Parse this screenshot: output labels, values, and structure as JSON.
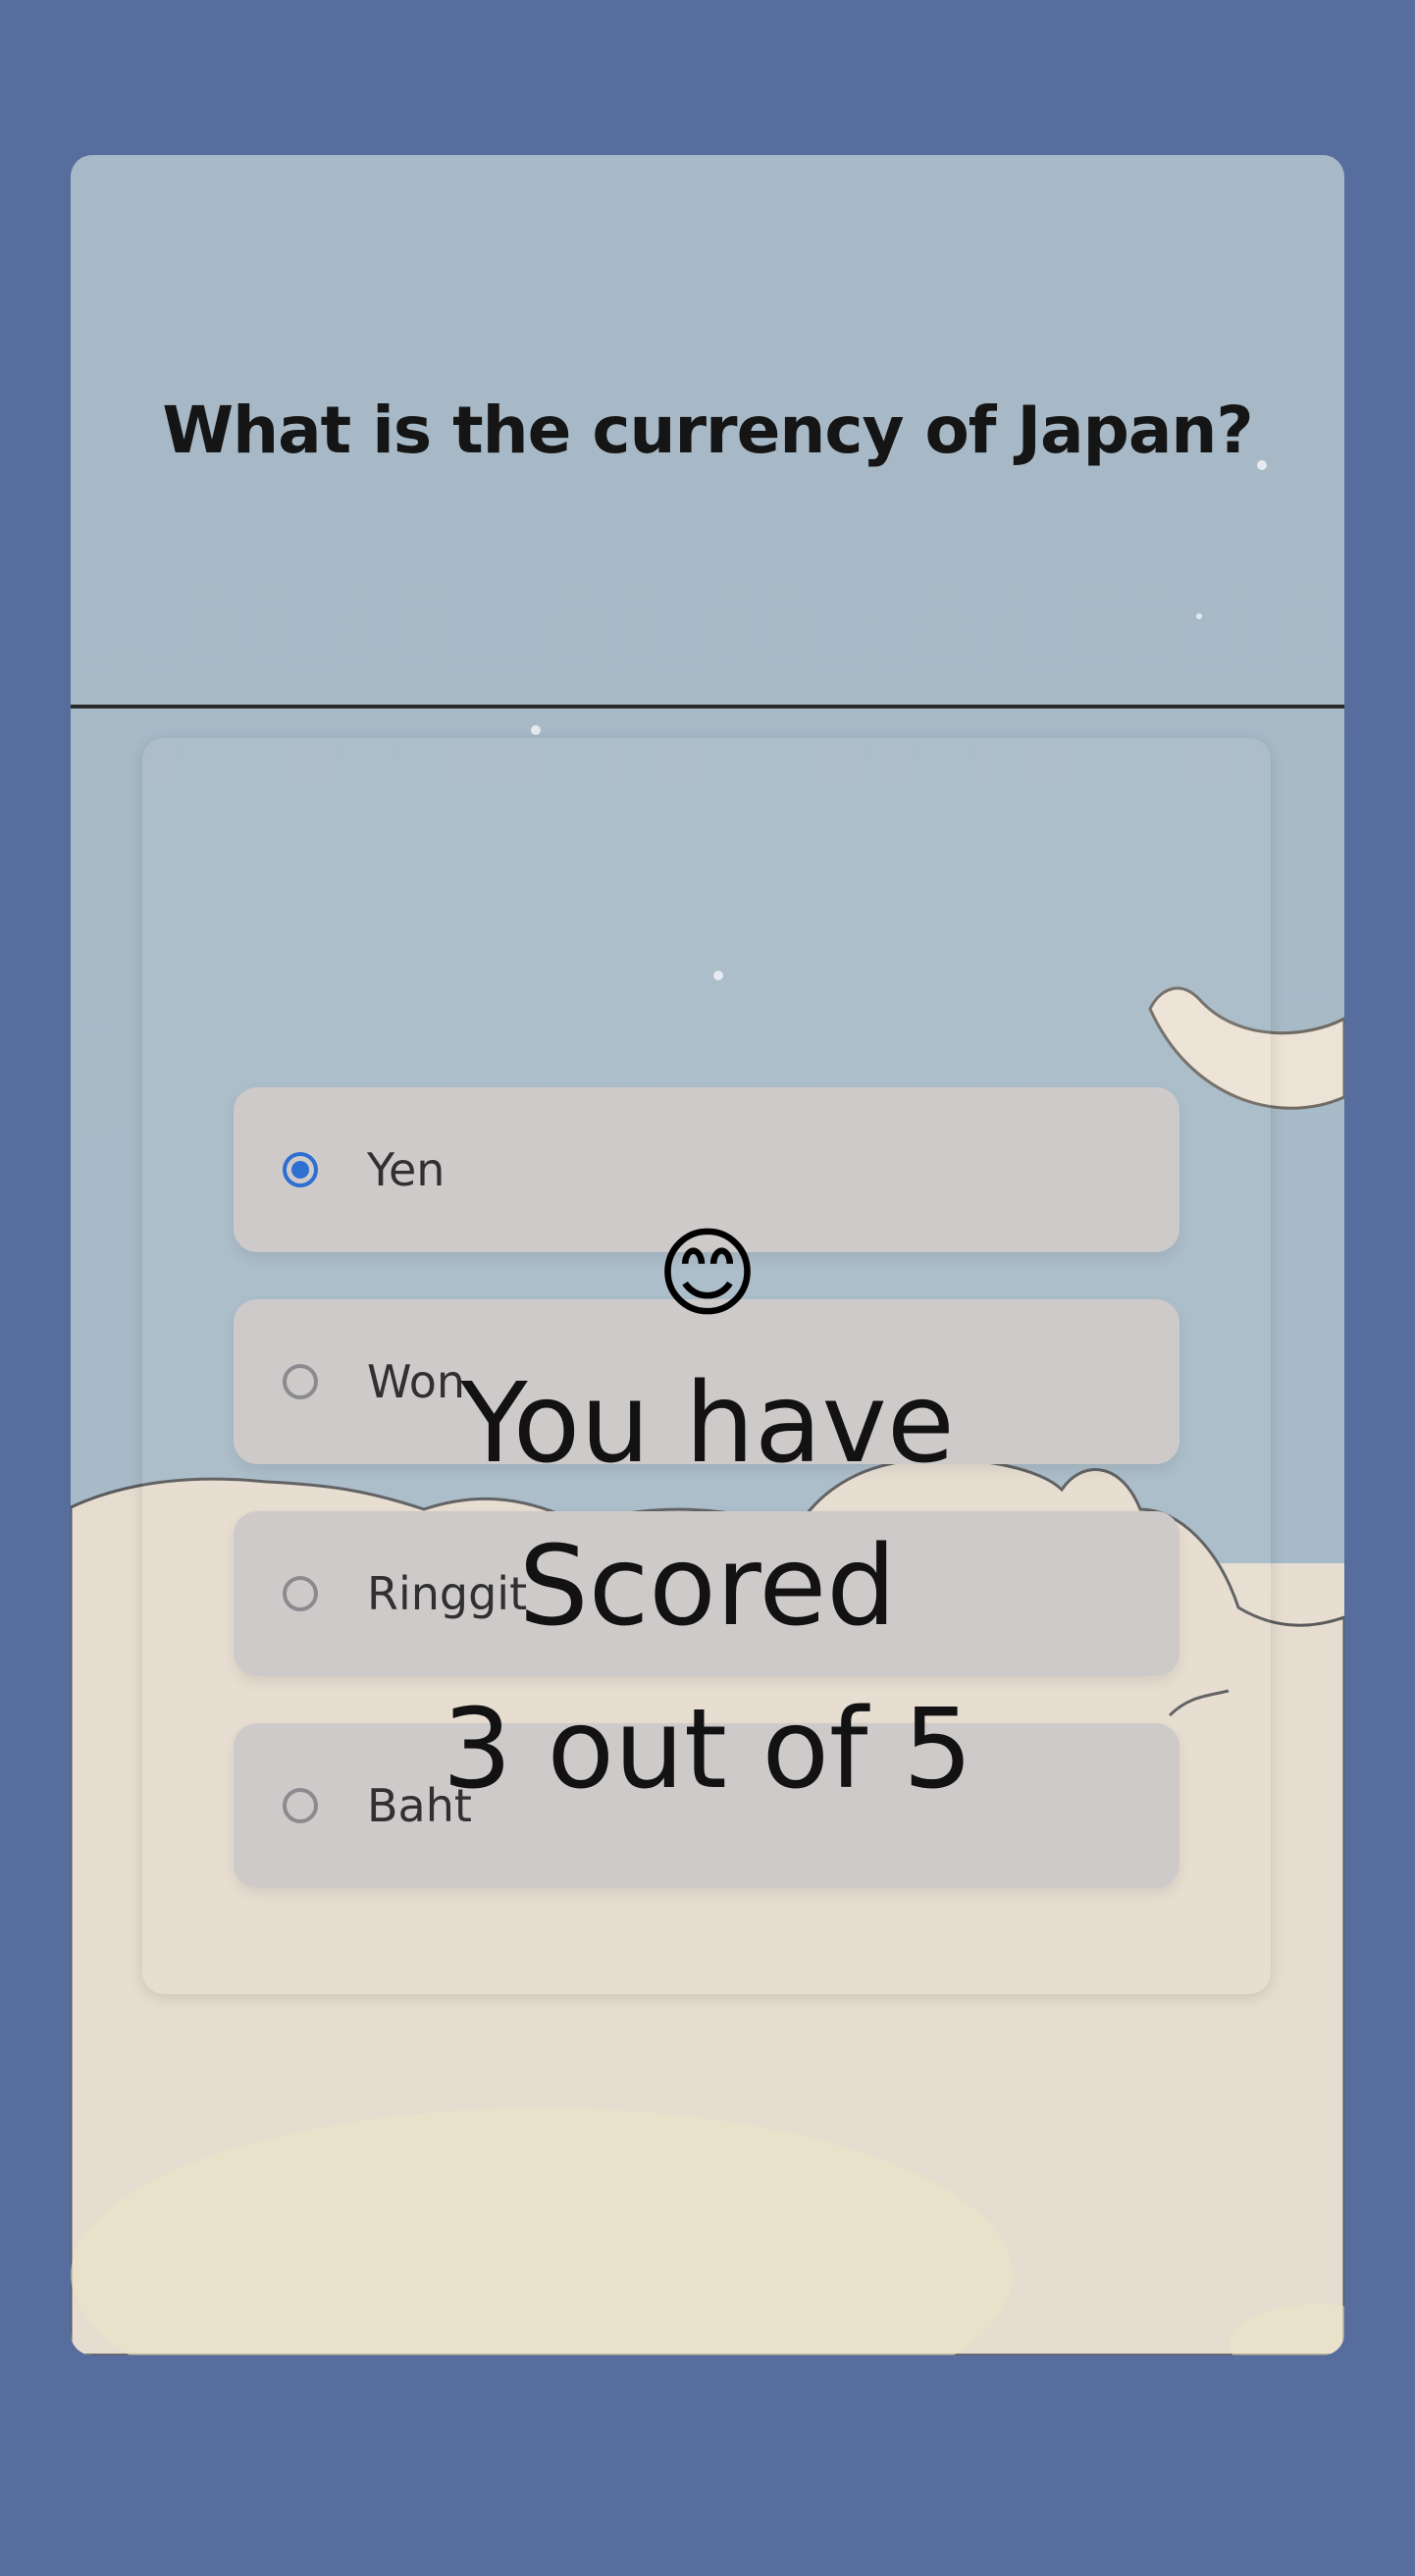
{
  "question": {
    "text": "What is the currency of Japan?"
  },
  "options": [
    {
      "label": "Yen",
      "selected": true
    },
    {
      "label": "Won",
      "selected": false
    },
    {
      "label": "Ringgit",
      "selected": false
    },
    {
      "label": "Baht",
      "selected": false
    }
  ],
  "result": {
    "emoji": "😊",
    "line1": "You have",
    "line2": "Scored",
    "line3": "3 out of 5"
  },
  "colors": {
    "page_background": "#566d9d",
    "sky": "#a7b9c6",
    "clouds": "#e7ddd1",
    "option_background": "#cecaca",
    "radio_selected": "#2e6fd2",
    "radio_unselected": "#8b8b8f"
  },
  "icons": {
    "decor": [
      "moon-icon",
      "clouds-illustration"
    ]
  }
}
